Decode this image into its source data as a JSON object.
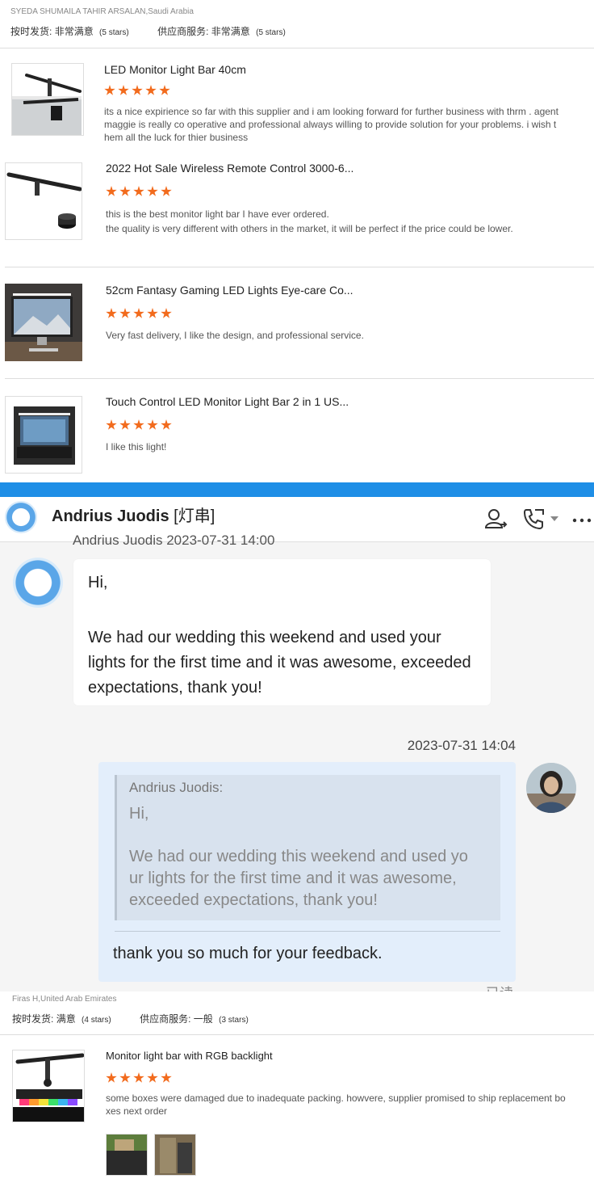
{
  "review1": {
    "reviewer": "SYEDA SHUMAILA TAHIR ARSALAN,Saudi Arabia",
    "shipping_label": "按时发货:",
    "shipping_value": "非常满意",
    "shipping_stars": "(5 stars)",
    "service_label": "供应商服务:",
    "service_value": "非常满意",
    "service_stars": "(5 stars)",
    "products": [
      {
        "title": "LED Monitor Light Bar 40cm",
        "rating": 5,
        "line1": "its a nice expirience so far with this supplier and i am looking forward for further business with thrm . agent",
        "line2": "maggie is really co operative and professional always willing to provide solution for your problems. i wish t",
        "line3": "hem all the luck for thier business"
      },
      {
        "title": "2022 Hot Sale Wireless Remote Control 3000-6...",
        "rating": 5,
        "line1": "this is the best monitor light bar I have ever ordered.",
        "line2": "the quality is very different with others in the market, it will be perfect if the price could be lower."
      },
      {
        "title": "52cm Fantasy Gaming LED Lights Eye-care Co...",
        "rating": 5,
        "line1": "Very fast delivery, I like the design, and professional service."
      },
      {
        "title": "Touch Control LED Monitor Light Bar 2 in 1 US...",
        "rating": 5,
        "line1": "I like this light!"
      }
    ]
  },
  "chat": {
    "contact_name": "Andrius Juodis",
    "contact_tag": "[灯串]",
    "cut_header": "Andrius Juodis   2023-07-31 14:00",
    "incoming_hi": "Hi,",
    "incoming_msg": "We had our wedding this weekend and used your lights for the first time and it was awesome, exceeded expectations, thank you!",
    "timestamp": "2023-07-31 14:04",
    "quote_name": "Andrius Juodis:",
    "quote_hi": "Hi,",
    "quote_line1": "We had our wedding this weekend and used yo",
    "quote_line2": "ur lights for the first time and it was awesome,",
    "quote_line3": "exceeded expectations, thank you!",
    "reply": "thank you so much for your feedback.",
    "read_status": "已读",
    "accent": "#1e8ee6"
  },
  "review2": {
    "reviewer": "Firas H,United Arab Emirates",
    "shipping_label": "按时发货:",
    "shipping_value": "满意",
    "shipping_stars": "(4 stars)",
    "service_label": "供应商服务:",
    "service_value": "一般",
    "service_stars": "(3 stars)",
    "product_title": "Monitor light bar with RGB backlight",
    "rating": 5,
    "line1": "some boxes were damaged due to inadequate packing. howvere, supplier promised to ship replacement bo",
    "line2": "xes next order"
  },
  "star_color": "#f26b1d"
}
